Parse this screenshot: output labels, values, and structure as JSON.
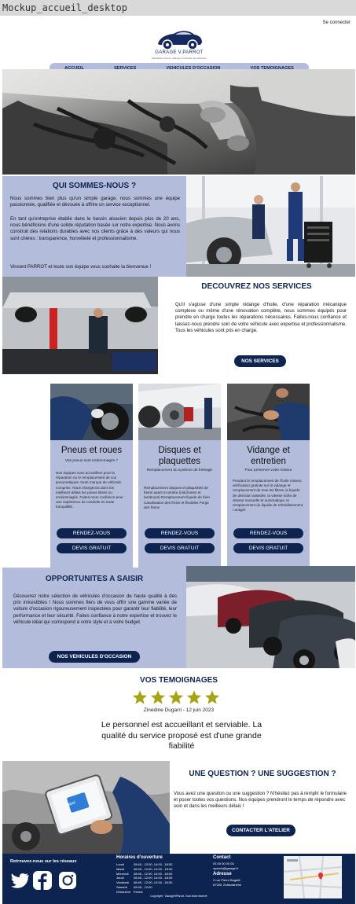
{
  "frame": {
    "title": "Mockup_accueil_desktop"
  },
  "header": {
    "login": "Se connecter",
    "logo_name": "GARAGE V.PARROT",
    "logo_tagline": "Réparation Freins, vidange et entretien de véhicules"
  },
  "nav": {
    "items": [
      "ACCUEIL",
      "SERVICES",
      "VEHICULES D'OCCASION",
      "VOS TEMOIGNAGES"
    ]
  },
  "about": {
    "title": "QUI SOMMES-NOUS ?",
    "p1": "Nous sommes bien plus qu'un simple garage, nous sommes une équipe passionnée, qualifiée et dévouée à offrire un service exceptionnel.",
    "p2": "En tant qu'entreprise établie dans le bassin alsacien depuis plus de 20 ans, nous bénéficions d'une solide réputation basée sur notre expertise. Nous avons construit des relations durables avec nos clients grâce à des valeurs qui nous sont chères : transparence, honnêteté et professionnalisme.",
    "p3": "Vincent PARROT et toute son équipe vous souhaite la bienvenue !"
  },
  "services_intro": {
    "title": "DECOUVREZ NOS SERVICES",
    "text": "Qu'il s'agisse d'une simple vidange d'huile, d'une réparation mécanique complexe ou même d'une rénovation complète, nous sommes équipés pour prendre en charge toutes les réparations nécessaires. Faites-nous confiance et laissez-nous prendre soin de votre véhicule avec expertise et professionnalisme. Tous les véhicules sont pris en charge.",
    "button": "NOS SERVICES"
  },
  "cards": [
    {
      "title": "Pneus et roues",
      "subtitle": "Vos pneus sont endommagés ?",
      "text": "Nos équipes vous accueillent pour la réparation ou le remplacement de vos pneumatiques, toute marque de véhicule comprise. Nous changeons dans les meilleurs délais les pneus lisses ou endommagés. Faites-nous confiance pour une expérience de conduite en toute tranquillité.",
      "btn1": "RENDEZ-VOUS",
      "btn2": "DEVIS GRATUIT"
    },
    {
      "title": "Disques et plaquettes",
      "subtitle": "Remplacement du système de freinage",
      "text": "Remplacement disques et plaquettes de freins avant et arrière (mâchoires et tambours) Remplacement liquide de frein Canalisation des freins et flexibles Purge des freins",
      "btn1": "RENDEZ-VOUS",
      "btn2": "DEVIS GRATUIT"
    },
    {
      "title": "Vidange et entretien",
      "subtitle": "Pour préserver votre moteur",
      "text": "Pendant le remplacement de l'huile moteur, vérification gratuite sur la vidange et remplacement de tous les filtres, le liquide de direction assistée, la vitesse boîte de vitesse manuelle et automatique, le remplacement du liquide de refroidissement / antigel.",
      "btn1": "RENDEZ-VOUS",
      "btn2": "DEVIS GRATUIT"
    }
  ],
  "opportunities": {
    "title": "OPPORTUNITES A SAISIR",
    "text": "Découvrez notre sélection de véhicules d'occasion de haute qualité à des prix irrésistibles ! Nous sommes fiers de vous offrir une gamme variée de voiture d'occasion rigoureusement inspectées pour garantir leur fiabilité, leur performance et leur sécurité. Faites confiance à notre expertise et trouvez le véhicule idéal qui correspond à votre style et à votre budget.",
    "button": "NOS VEHICULES D'OCCASION"
  },
  "testimonials": {
    "title": "VOS TEMOIGNAGES",
    "rating": 5,
    "star_color": "#a7a313",
    "author": "Zinedine Dugarri - 12 juin 2023",
    "quote": "Le personnel est accueillant et serviable. La qualité du service proposé est d'une grande fiabilité"
  },
  "contact_section": {
    "title": "UNE QUESTION ? UNE SUGGESTION ?",
    "text": "Vous avez une question ou une suggestion ? N'hésitez pas à remplir le formulaire et poser toutes vos questions. Nos équipes prendront le temps de répondre avec soin et dans les meilleurs délais !",
    "button": "CONTACTER L'ATELIER",
    "tablet_label": "Label"
  },
  "footer": {
    "social_title": "Retrouvez-nous sur les réseaux",
    "hours_title": "Horaires d'ouverture",
    "hours": [
      [
        "Lundi",
        "08:45 - 12:00, 14:00 - 18:00"
      ],
      [
        "Mardi",
        "08:45 - 12:00, 14:00 - 18:00"
      ],
      [
        "Mercredi",
        "08:45 - 12:00, 14:00 - 18:00"
      ],
      [
        "Jeudi",
        "08:45 - 12:00, 14:00 - 18:00"
      ],
      [
        "Vendredi",
        "08:45 - 12:00, 14:00 - 18:00"
      ],
      [
        "Samedi",
        "09:45 - 12:00"
      ],
      [
        "Dimanche",
        "Fermé"
      ]
    ],
    "contact_title": "Contact",
    "phone": "03 00 00 00 00",
    "email": "vparrot@garage.fr",
    "address_title": "Adresse",
    "address1": "2 rue Pierre Bugatti",
    "address2": "67200, Eckbolsheim",
    "copyright": "Copyright : GarageVParrot. Tout droit réservé",
    "colors": {
      "footer_bg": "#0e2450",
      "accent": "#b4bcdb"
    }
  }
}
